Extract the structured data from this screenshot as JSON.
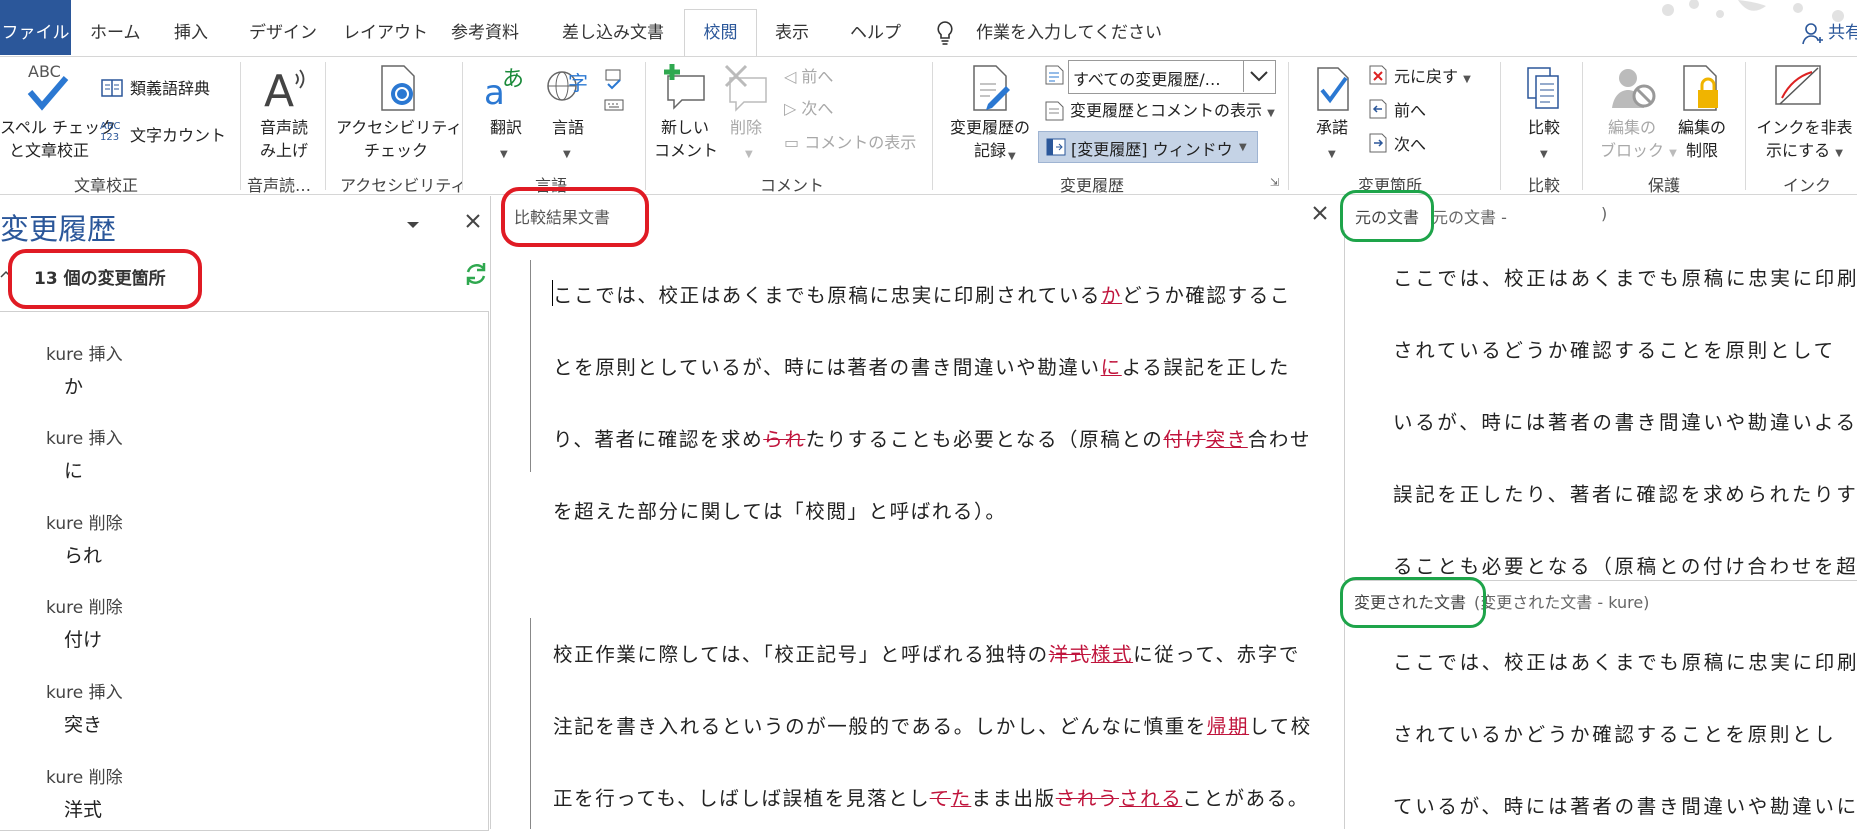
{
  "tabs": {
    "file": "ファイル",
    "home": "ホーム",
    "insert": "挿入",
    "design": "デザイン",
    "layout": "レイアウト",
    "references": "参考資料",
    "mailings": "差し込み文書",
    "review": "校閲",
    "view": "表示",
    "help": "ヘルプ",
    "tellme": "作業を入力してください",
    "share": "共有"
  },
  "ribbon": {
    "proofing": {
      "spell_line1": "スペル チェック",
      "spell_line2": "と文章校正",
      "spell_icon_text": "ABC",
      "thesaurus": "類義語辞典",
      "wordcount": "文字カウント",
      "wordcount_icon_text": "ABC 123",
      "label": "文章校正"
    },
    "speech": {
      "read_line1": "音声読",
      "read_line2": "み上げ",
      "label": "音声読…"
    },
    "access": {
      "check_line1": "アクセシビリティ",
      "check_line2": "チェック",
      "label": "アクセシビリティ"
    },
    "language": {
      "translate": "翻訳",
      "language": "言語",
      "label": "言語"
    },
    "comments": {
      "new_line1": "新しい",
      "new_line2": "コメント",
      "delete": "削除",
      "prev": "前へ",
      "next": "次へ",
      "show": "コメントの表示",
      "label": "コメント"
    },
    "tracking": {
      "track_line1": "変更履歴の",
      "track_line2": "記録",
      "display_select": "すべての変更履歴/…",
      "show_markup": "変更履歴とコメントの表示",
      "pane": "[変更履歴] ウィンドウ",
      "label": "変更履歴"
    },
    "changes": {
      "accept": "承諾",
      "reject": "元に戻す",
      "prev": "前へ",
      "next": "次へ",
      "label": "変更箇所"
    },
    "compare": {
      "compare": "比較",
      "label": "比較"
    },
    "protect": {
      "block_line1": "編集の",
      "block_line2": "ブロック",
      "restrict_line1": "編集の",
      "restrict_line2": "制限",
      "label": "保護"
    },
    "ink": {
      "hide_line1": "インクを非表",
      "hide_line2": "示にする",
      "label": "インク"
    }
  },
  "revisions_pane": {
    "title": "変更履歴",
    "summary": "13 個の変更箇所",
    "items": [
      {
        "who": "kure 挿入",
        "text": "か"
      },
      {
        "who": "kure 挿入",
        "text": "に"
      },
      {
        "who": "kure 削除",
        "text": "られ"
      },
      {
        "who": "kure 削除",
        "text": "付け"
      },
      {
        "who": "kure 挿入",
        "text": "突き"
      },
      {
        "who": "kure 削除",
        "text": "洋式"
      }
    ]
  },
  "compared": {
    "header": "比較結果文書",
    "p1": {
      "l1a": "ここでは、校正はあくまでも原稿に忠実に印刷されている",
      "l1ins": "か",
      "l1b": "どうか確認するこ",
      "l2a": "とを原則としているが、時には著者の書き間違いや勘違い",
      "l2ins": "に",
      "l2b": "よる誤記を正した",
      "l3a": "り、著者に確認を求め",
      "l3del": "られ",
      "l3b": "たりすることも必要となる（原稿との",
      "l3del2": "付け",
      "l3ins": "突き",
      "l3c": "合わせ",
      "l4": "を超えた部分に関しては「校閲」と呼ばれる）。"
    },
    "p2": {
      "l1a": "校正作業に際しては、「校正記号」と呼ばれる独特の",
      "l1del": "洋式",
      "l1ins": "様式",
      "l1b": "に従って、赤字で",
      "l2a": "注記を書き入れるというのが一般的である。しかし、どんなに慎重を",
      "l2ins": "帰期",
      "l2b": "して校",
      "l3a": "正を行っても、しばしば誤植を見落とし",
      "l3del": "て",
      "l3ins": "た",
      "l3b": "まま出版",
      "l3del2": "されう",
      "l3ins2": "される",
      "l3c": "ことがある。"
    }
  },
  "original": {
    "header_tag": "元の文書",
    "header_rest": "元の文書 -",
    "header_close": ")",
    "lines": [
      "ここでは、校正はあくまでも原稿に忠実に印刷",
      "されているどうか確認することを原則として",
      "いるが、時には著者の書き間違いや勘違いよる",
      "誤記を正したり、著者に確認を求められたりす",
      "ることも必要となる（原稿との付け合わせを超"
    ]
  },
  "revised": {
    "header_tag": "変更された文書",
    "header_rest": "(変更された文書 - kure)",
    "lines": [
      "ここでは、校正はあくまでも原稿に忠実に印刷",
      "されているかどうか確認することを原則とし",
      "ているが、時には著者の書き間違いや勘違いに"
    ]
  },
  "colors": {
    "file_tab": "#2b579a",
    "accent": "#2b579a",
    "revision_mark": "#c0143c",
    "highlight_red": "#e01b24",
    "highlight_green": "#1ea44a"
  }
}
